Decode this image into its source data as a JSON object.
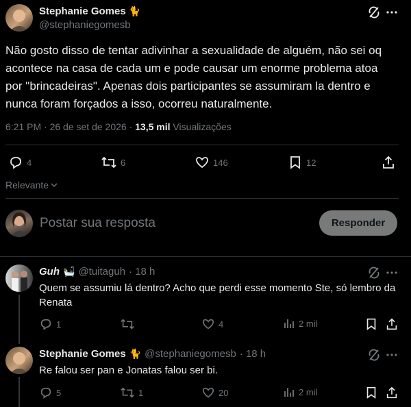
{
  "main_post": {
    "author_name": "Stephanie Gomes",
    "author_emoji": "🐈",
    "author_handle": "@stephaniegomesb",
    "text": "Não gosto disso de tentar adivinhar a sexualidade de alguém, não sei oq acontece na casa de cada um e pode causar um enorme problema atoa por \"brincadeiras\". Apenas dois participantes se assumiram la dentro e nunca foram forçados a isso, ocorreu naturalmente.",
    "time": "6:21 PM · 26 de set de 2026 · ",
    "views_count": "13,5 mil",
    "views_label": " Visualizações",
    "stats": {
      "replies": "4",
      "reposts": "6",
      "likes": "146",
      "bookmarks": "12"
    }
  },
  "sort_label": "Relevante",
  "composer": {
    "placeholder": "Postar sua resposta",
    "button": "Responder"
  },
  "replies": [
    {
      "author_name": "Guh",
      "author_emoji": "🛀",
      "author_handle": "@tuitaguh",
      "time": "· 18 h",
      "text": "Quem se assumiu lá dentro? Acho que perdi esse momento Ste, só lembro da Renata",
      "stats": {
        "replies": "1",
        "reposts": "",
        "likes": "4",
        "views": "2 mil"
      }
    },
    {
      "author_name": "Stephanie Gomes",
      "author_emoji": "🐈",
      "author_handle": "@stephaniegomesb",
      "time": "· 18 h",
      "text": "Re falou ser pan e Jonatas falou ser bi.",
      "stats": {
        "replies": "5",
        "reposts": "1",
        "likes": "20",
        "views": "2 mil"
      }
    }
  ],
  "icons": {
    "more": "more-horizontal-icon",
    "grok": "grok-icon",
    "reply": "reply-icon",
    "repost": "repost-icon",
    "like": "like-icon",
    "bookmark": "bookmark-icon",
    "share": "share-icon",
    "views": "views-icon",
    "chevron": "chevron-down-icon"
  },
  "colors": {
    "background": "#000000",
    "text": "#e7e9ea",
    "muted": "#71767b",
    "divider": "#2f3336",
    "button": "#787a7a"
  }
}
